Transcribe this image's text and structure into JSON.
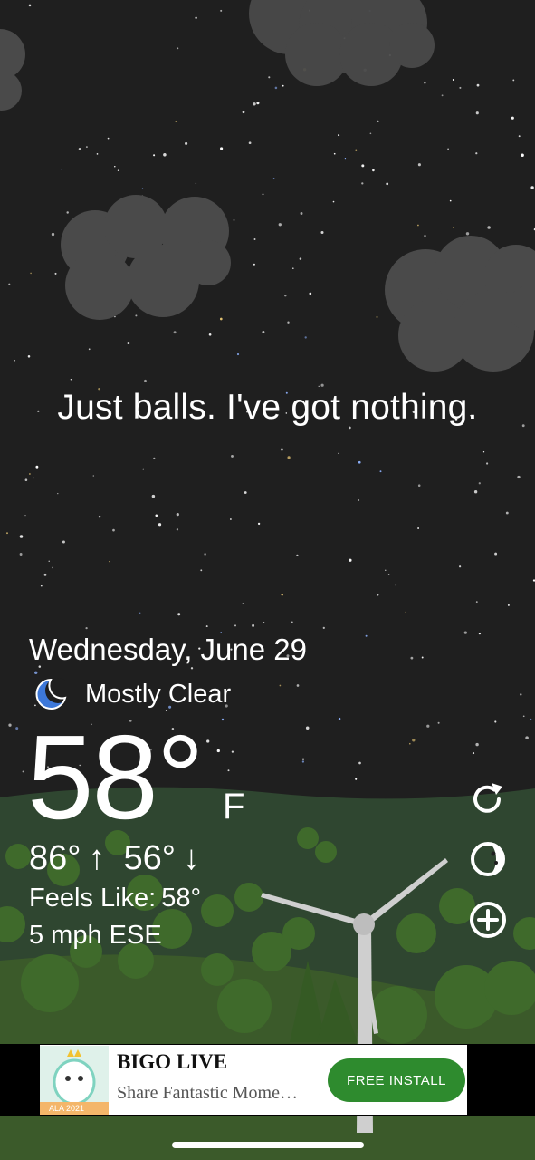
{
  "quip": "Just balls. I've got nothing.",
  "date": "Wednesday, June 29",
  "condition": {
    "icon": "moon-icon",
    "label": "Mostly Clear"
  },
  "temperature": {
    "value": "58°",
    "unit": "F"
  },
  "high_low": {
    "high": "86°",
    "high_arrow": "↑",
    "low": "56°",
    "low_arrow": "↓"
  },
  "feels_like": {
    "label": "Feels Like:",
    "value": "58°"
  },
  "wind": "5 mph ESE",
  "controls": {
    "refresh_icon": "refresh-icon",
    "moon_phase_icon": "moon-phase-icon",
    "add_icon": "plus-circle-icon"
  },
  "ad": {
    "title": "BIGO LIVE",
    "subtitle": "Share Fantastic Mome…",
    "button": "FREE INSTALL",
    "logo_text": "ALA 2021",
    "accent": "#2e8b2e"
  },
  "colors": {
    "sky": "#1f1f1f",
    "ground": "#3b5a2a",
    "cloud": "#4a4a4a"
  }
}
